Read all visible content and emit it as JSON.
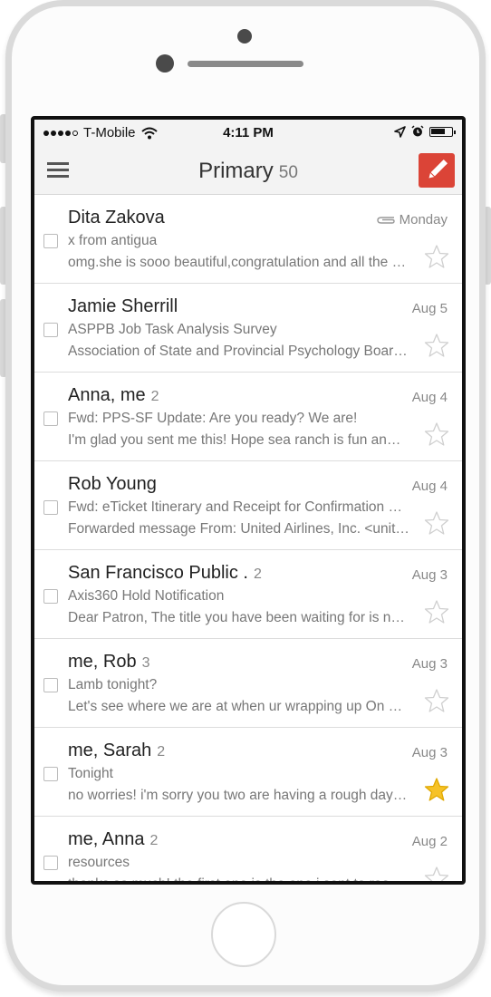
{
  "status_bar": {
    "carrier": "T-Mobile",
    "time": "4:11 PM",
    "battery_level": 0.7,
    "icons": [
      "signal-dots-icon",
      "wifi-icon",
      "location-arrow-icon",
      "alarm-icon",
      "battery-icon"
    ]
  },
  "app_bar": {
    "title": "Primary",
    "count": "50",
    "menu_icon": "hamburger-icon",
    "compose_icon": "pencil-icon",
    "compose_color": "#db4437"
  },
  "emails": [
    {
      "sender": "Dita Zakova",
      "count": "",
      "date": "Monday",
      "attachment": true,
      "subject": "x from antigua",
      "snippet": "omg.she is sooo beautiful,congratulation and all the …",
      "starred": false
    },
    {
      "sender": "Jamie Sherrill",
      "count": "",
      "date": "Aug 5",
      "attachment": false,
      "subject": "ASPPB Job Task Analysis Survey",
      "snippet": "Association of State and Provincial Psychology Boar…",
      "starred": false
    },
    {
      "sender": "Anna, me",
      "count": "2",
      "date": "Aug 4",
      "attachment": false,
      "subject": "Fwd: PPS-SF Update: Are you ready? We are!",
      "snippet": "I'm glad you sent me this! Hope sea ranch is fun an…",
      "starred": false
    },
    {
      "sender": "Rob Young",
      "count": "",
      "date": "Aug 4",
      "attachment": false,
      "subject": "Fwd: eTicket Itinerary and Receipt for Confirmation …",
      "snippet": "Forwarded message From: United Airlines, Inc. <unit…",
      "starred": false
    },
    {
      "sender": "San Francisco Public .",
      "count": "2",
      "date": "Aug 3",
      "attachment": false,
      "subject": "Axis360 Hold Notification",
      "snippet": "Dear Patron, The title you have been waiting for is n…",
      "starred": false
    },
    {
      "sender": "me, Rob",
      "count": "3",
      "date": "Aug 3",
      "attachment": false,
      "subject": "Lamb tonight?",
      "snippet": "Let's see where we are at when ur wrapping up On …",
      "starred": false
    },
    {
      "sender": "me, Sarah",
      "count": "2",
      "date": "Aug 3",
      "attachment": false,
      "subject": "Tonight",
      "snippet": "no worries! i'm sorry you two are having a rough day…",
      "starred": true
    },
    {
      "sender": "me, Anna",
      "count": "2",
      "date": "Aug 2",
      "attachment": false,
      "subject": "resources",
      "snippet": "thanks so much! the first one is the one i sent to roo…",
      "starred": false
    }
  ],
  "colors": {
    "star_filled": "#f6c227",
    "star_empty": "#cfcfcf"
  }
}
